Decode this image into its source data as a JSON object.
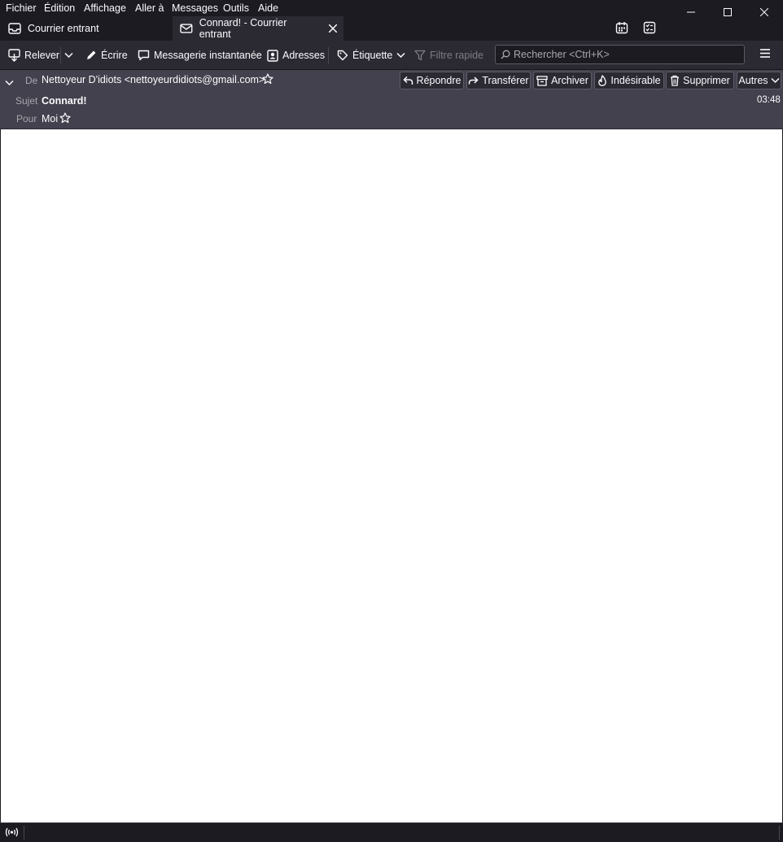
{
  "menu": [
    "Fichier",
    "Édition",
    "Affichage",
    "Aller à",
    "Messages",
    "Outils",
    "Aide"
  ],
  "tabs": [
    {
      "label": "Courrier entrant",
      "icon": "inbox-icon"
    },
    {
      "label": "Connard! - Courrier entrant",
      "icon": "envelope-icon"
    }
  ],
  "toolbar": {
    "get_messages": "Relever",
    "write": "Écrire",
    "chat": "Messagerie instantanée",
    "address_book": "Adresses",
    "tag": "Étiquette",
    "quick_filter": "Filtre rapide",
    "search_placeholder": "Rechercher <Ctrl+K>"
  },
  "header": {
    "from_label": "De",
    "from_value": "Nettoyeur D'idiots <nettoyeurdidiots@gmail.com>",
    "subject_label": "Sujet",
    "subject_value": "Connard!",
    "to_label": "Pour",
    "to_value": "Moi",
    "time": "03:48",
    "buttons": {
      "reply": "Répondre",
      "forward": "Transférer",
      "archive": "Archiver",
      "junk": "Indésirable",
      "delete": "Supprimer",
      "other": "Autres"
    }
  },
  "colors": {
    "background": "#1c1b22",
    "toolbar": "#2b2a33",
    "header_pane": "#42414d",
    "message_body": "#ffffff"
  }
}
